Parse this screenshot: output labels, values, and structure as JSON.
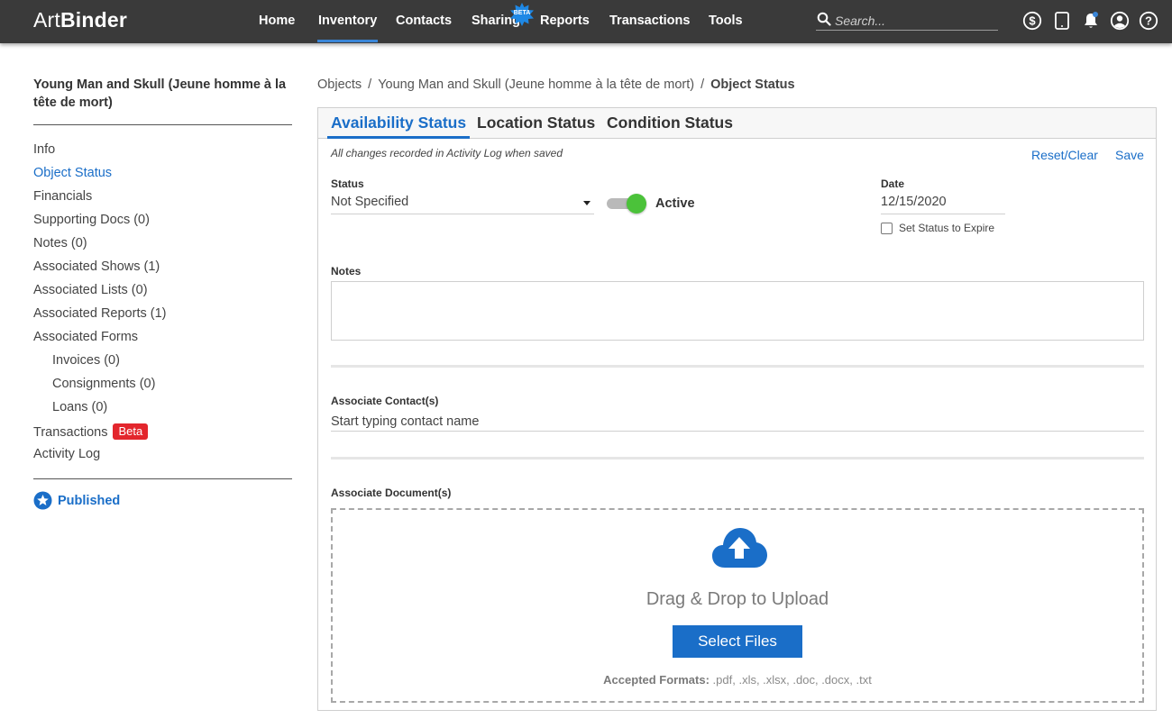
{
  "app": {
    "logo_light": "Art",
    "logo_bold": "Binder"
  },
  "nav": {
    "items": [
      "Home",
      "Inventory",
      "Contacts",
      "Sharing",
      "Reports",
      "Transactions",
      "Tools"
    ],
    "active": "Inventory",
    "sharing_badge": "BETA",
    "search_placeholder": "Search..."
  },
  "sidebar": {
    "title": "Young Man and Skull (Jeune homme à la tête de mort)",
    "items": [
      {
        "label": "Info"
      },
      {
        "label": "Object Status"
      },
      {
        "label": "Financials"
      },
      {
        "label": "Supporting Docs (0)"
      },
      {
        "label": "Notes (0)"
      },
      {
        "label": "Associated Shows (1)"
      },
      {
        "label": "Associated Lists (0)"
      },
      {
        "label": "Associated Reports (1)"
      },
      {
        "label": "Associated Forms"
      },
      {
        "label": "Invoices (0)"
      },
      {
        "label": "Consignments (0)"
      },
      {
        "label": "Loans (0)"
      },
      {
        "label": "Transactions"
      },
      {
        "label": "Activity Log"
      }
    ],
    "transactions_badge": "Beta",
    "published_label": "Published"
  },
  "breadcrumb": {
    "root": "Objects",
    "object": "Young Man and Skull (Jeune homme à la tête de mort)",
    "current": "Object Status"
  },
  "tabs": [
    "Availability Status",
    "Location Status",
    "Condition Status"
  ],
  "form": {
    "changes_note": "All changes recorded in Activity Log when saved",
    "reset_label": "Reset/Clear",
    "save_label": "Save",
    "status_label": "Status",
    "status_value": "Not Specified",
    "toggle_label": "Active",
    "toggle_on": true,
    "date_label": "Date",
    "date_value": "12/15/2020",
    "expire_label": "Set Status to Expire",
    "notes_label": "Notes",
    "contacts_label": "Associate Contact(s)",
    "contacts_placeholder": "Start typing contact name",
    "documents_label": "Associate Document(s)",
    "drag_text": "Drag & Drop to Upload",
    "select_files_label": "Select Files",
    "formats_label": "Accepted Formats:",
    "formats_value": ".pdf, .xls, .xlsx, .doc, .docx, .txt"
  },
  "colors": {
    "topbar": "#3a3a3a",
    "accent": "#1a6ec8",
    "toggle_on": "#4bc23a",
    "badge_red": "#e3262d"
  }
}
